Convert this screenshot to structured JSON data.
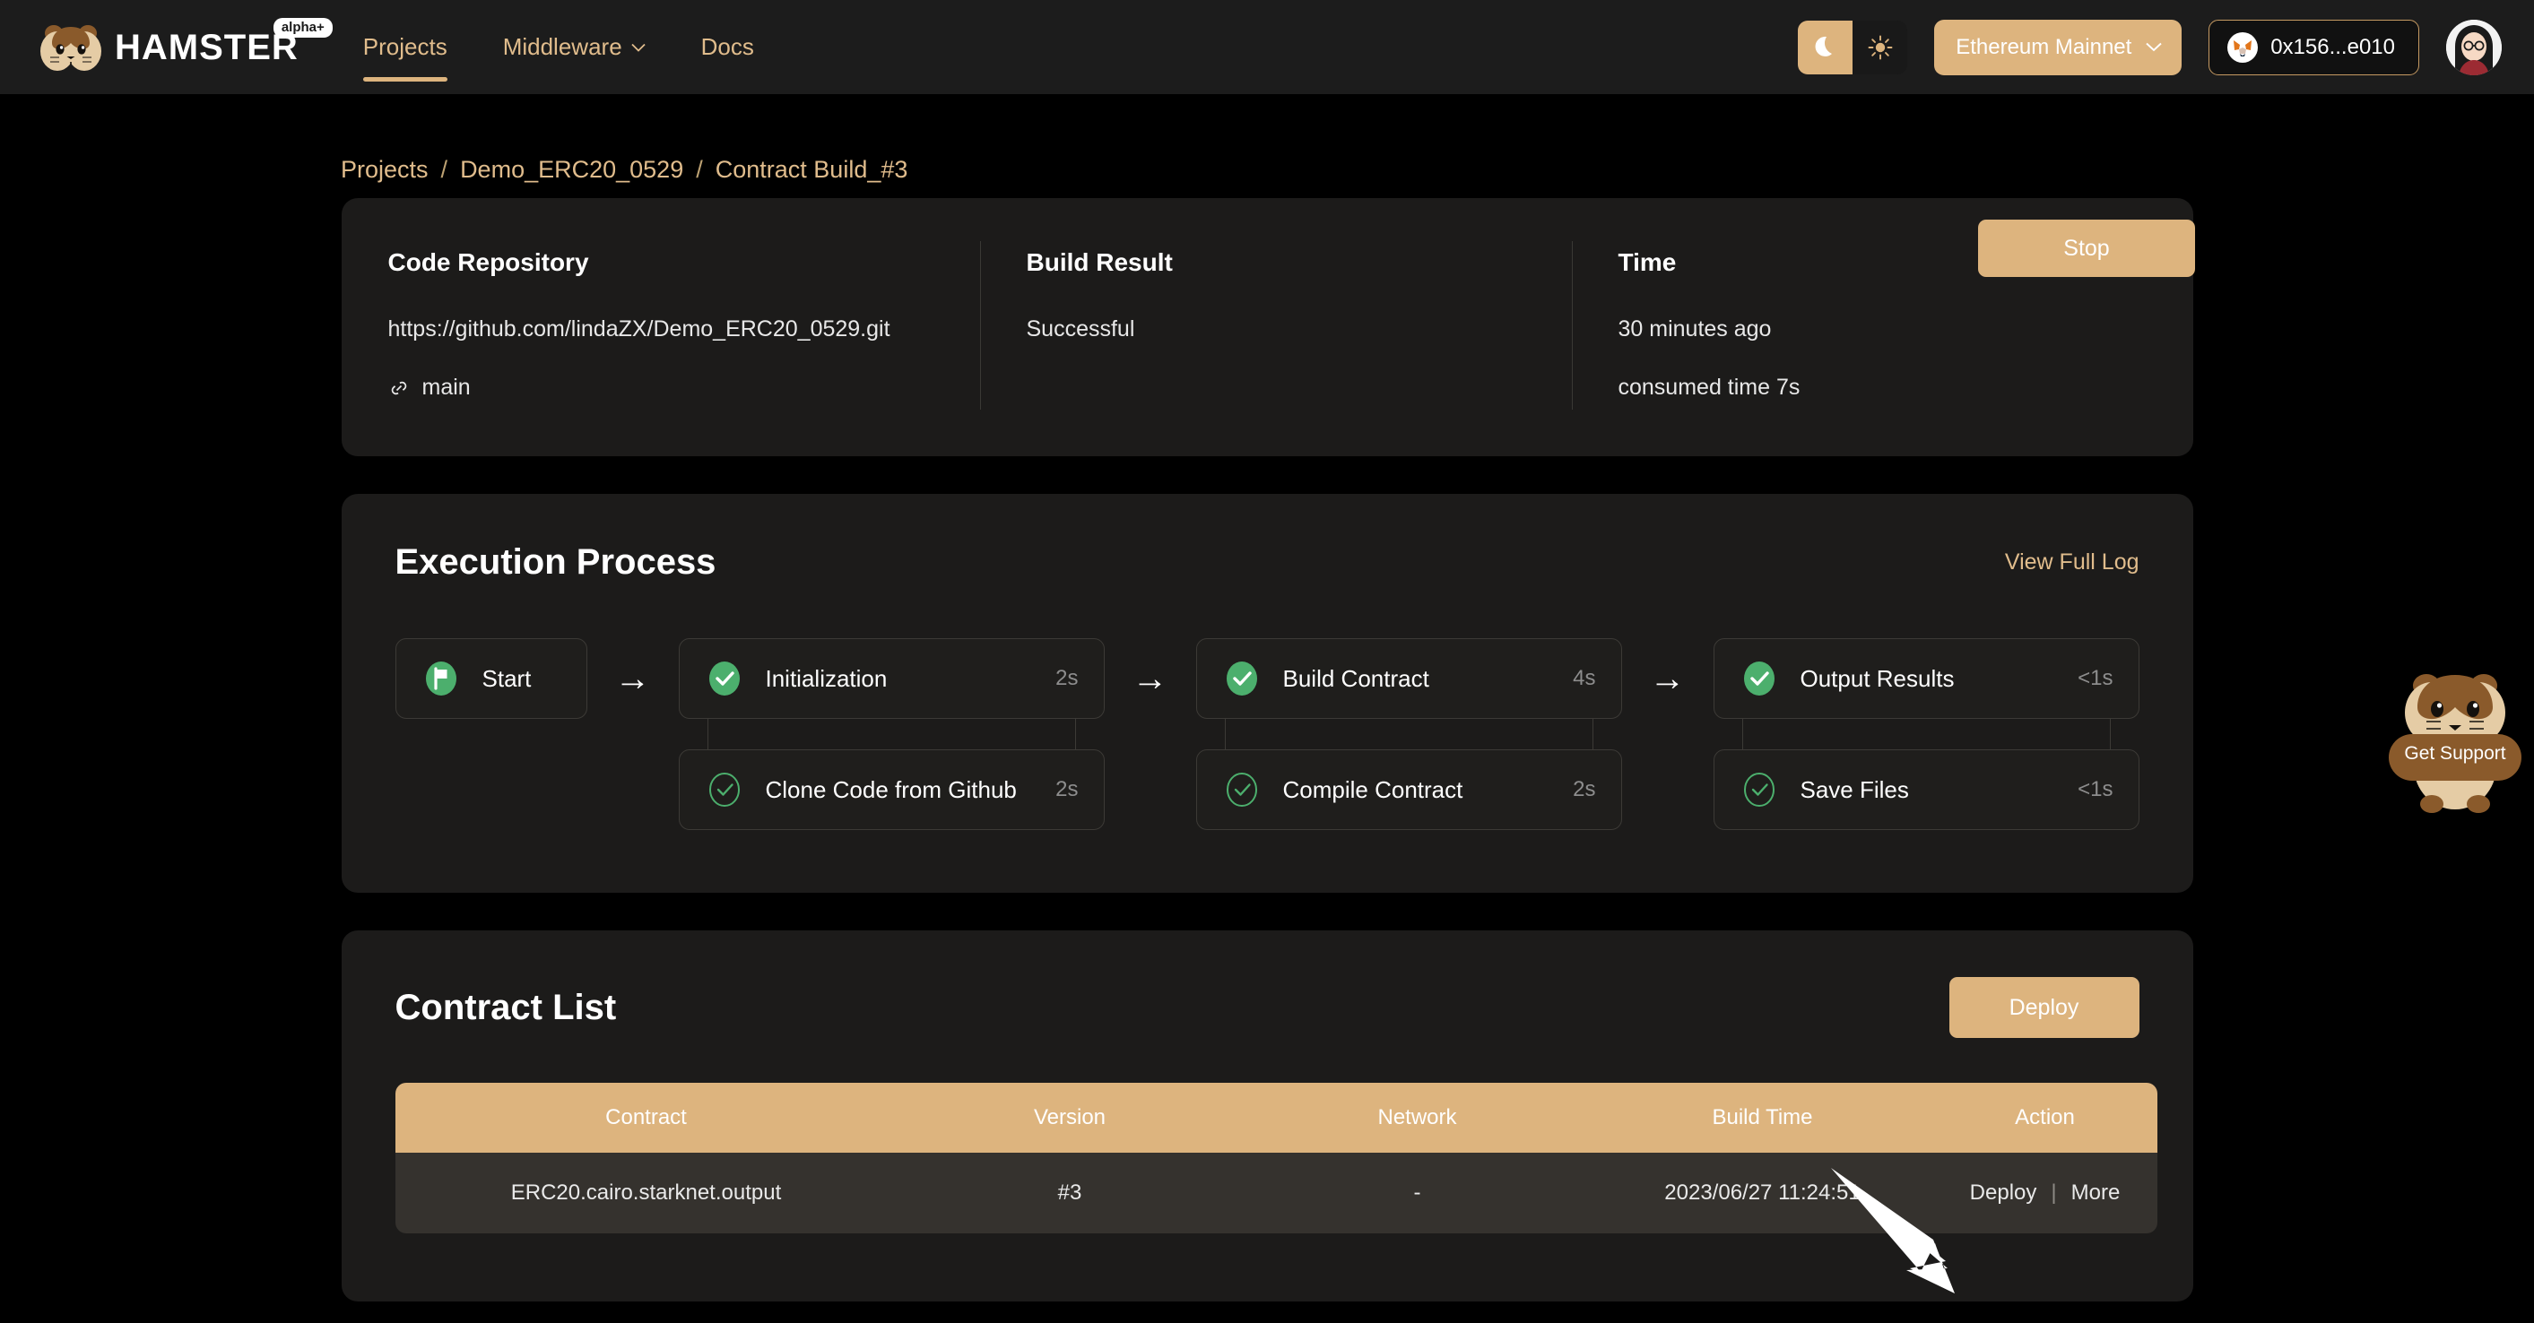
{
  "header": {
    "logo_text": "HAMSTER",
    "logo_badge": "alpha+",
    "nav": [
      {
        "label": "Projects",
        "active": true,
        "has_caret": false
      },
      {
        "label": "Middleware",
        "active": false,
        "has_caret": true
      },
      {
        "label": "Docs",
        "active": false,
        "has_caret": false
      }
    ],
    "theme_toggle": {
      "dark_icon": "moon-icon",
      "light_icon": "sun-icon",
      "selected": "dark"
    },
    "network": {
      "label": "Ethereum Mainnet",
      "caret_icon": "chevron-down-icon"
    },
    "wallet": {
      "address": "0x156...e010",
      "icon": "metamask-fox-icon"
    },
    "avatar_icon": "user-avatar"
  },
  "breadcrumb": {
    "items": [
      "Projects",
      "Demo_ERC20_0529",
      "Contract Build_#3"
    ],
    "separator": "/"
  },
  "stop_button": {
    "label": "Stop"
  },
  "summary": {
    "columns": [
      {
        "title": "Code Repository",
        "value": "https://github.com/lindaZX/Demo_ERC20_0529.git",
        "branch": "main",
        "branch_icon": "branch-link-icon"
      },
      {
        "title": "Build Result",
        "value": "Successful"
      },
      {
        "title": "Time",
        "value": "30 minutes ago",
        "extra": "consumed time 7s"
      }
    ]
  },
  "execution": {
    "title": "Execution Process",
    "full_log_label": "View Full Log",
    "arrow_glyph": "→",
    "start": {
      "label": "Start",
      "icon": "flag-filled-icon"
    },
    "stages": [
      {
        "main": {
          "label": "Initialization",
          "time": "2s",
          "icon": "check-circle-filled-icon"
        },
        "sub": {
          "label": "Clone Code from Github",
          "time": "2s",
          "icon": "check-circle-outline-icon"
        }
      },
      {
        "main": {
          "label": "Build Contract",
          "time": "4s",
          "icon": "check-circle-filled-icon"
        },
        "sub": {
          "label": "Compile Contract",
          "time": "2s",
          "icon": "check-circle-outline-icon"
        }
      },
      {
        "main": {
          "label": "Output Results",
          "time": "<1s",
          "icon": "check-circle-filled-icon"
        },
        "sub": {
          "label": "Save Files",
          "time": "<1s",
          "icon": "check-circle-outline-icon"
        }
      }
    ]
  },
  "contract_list": {
    "title": "Contract List",
    "deploy_button": "Deploy",
    "headers": [
      "Contract",
      "Version",
      "Network",
      "Build Time",
      "Action"
    ],
    "rows": [
      {
        "contract": "ERC20.cairo.starknet.output",
        "version": "#3",
        "network": "-",
        "build_time": "2023/06/27 11:24:51",
        "actions": {
          "deploy": "Deploy",
          "divider": "|",
          "more": "More"
        }
      }
    ]
  },
  "support_widget": {
    "label": "Get Support",
    "icon": "hamster-mascot-icon"
  },
  "annotation": {
    "icon": "white-arrow-pointer"
  },
  "colors": {
    "page_background": "#000000",
    "header_background": "#1c1c1c",
    "card_background": "#1c1b1a",
    "accent_gold": "#ddb47e",
    "accent_text": "#e0bc8c",
    "success_green": "#4caf6d",
    "table_row": "#35322e",
    "text_primary": "#ffffff",
    "text_muted": "#8d8d8d"
  }
}
